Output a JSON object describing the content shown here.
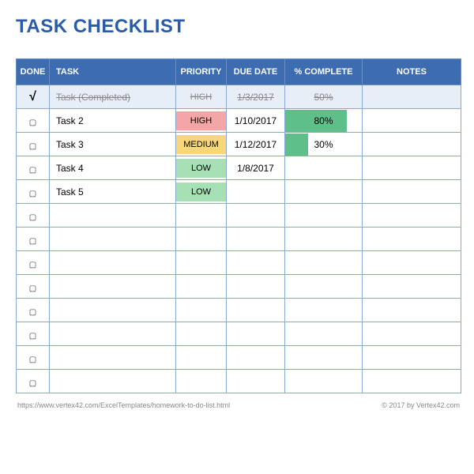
{
  "title": "TASK CHECKLIST",
  "columns": {
    "done": "DONE",
    "task": "TASK",
    "priority": "PRIORITY",
    "due": "DUE DATE",
    "pct": "% COMPLETE",
    "notes": "NOTES"
  },
  "priority_colors": {
    "HIGH": "#f4a6a6",
    "MEDIUM": "#f8d77a",
    "LOW": "#a8e0b5"
  },
  "rows": [
    {
      "done": true,
      "task": "Task (Completed)",
      "priority": "HIGH",
      "due": "1/3/2017",
      "pct": "50%",
      "pct_bar": 0,
      "notes": "",
      "strike": true
    },
    {
      "done": false,
      "task": "Task 2",
      "priority": "HIGH",
      "due": "1/10/2017",
      "pct": "80%",
      "pct_bar": 80,
      "notes": "",
      "strike": false
    },
    {
      "done": false,
      "task": "Task 3",
      "priority": "MEDIUM",
      "due": "1/12/2017",
      "pct": "30%",
      "pct_bar": 30,
      "notes": "",
      "strike": false
    },
    {
      "done": false,
      "task": "Task 4",
      "priority": "LOW",
      "due": "1/8/2017",
      "pct": "",
      "pct_bar": 0,
      "notes": "",
      "strike": false
    },
    {
      "done": false,
      "task": "Task 5",
      "priority": "LOW",
      "due": "",
      "pct": "",
      "pct_bar": 0,
      "notes": "",
      "strike": false
    },
    {
      "done": false,
      "task": "",
      "priority": "",
      "due": "",
      "pct": "",
      "pct_bar": 0,
      "notes": "",
      "strike": false
    },
    {
      "done": false,
      "task": "",
      "priority": "",
      "due": "",
      "pct": "",
      "pct_bar": 0,
      "notes": "",
      "strike": false
    },
    {
      "done": false,
      "task": "",
      "priority": "",
      "due": "",
      "pct": "",
      "pct_bar": 0,
      "notes": "",
      "strike": false
    },
    {
      "done": false,
      "task": "",
      "priority": "",
      "due": "",
      "pct": "",
      "pct_bar": 0,
      "notes": "",
      "strike": false
    },
    {
      "done": false,
      "task": "",
      "priority": "",
      "due": "",
      "pct": "",
      "pct_bar": 0,
      "notes": "",
      "strike": false
    },
    {
      "done": false,
      "task": "",
      "priority": "",
      "due": "",
      "pct": "",
      "pct_bar": 0,
      "notes": "",
      "strike": false
    },
    {
      "done": false,
      "task": "",
      "priority": "",
      "due": "",
      "pct": "",
      "pct_bar": 0,
      "notes": "",
      "strike": false
    },
    {
      "done": false,
      "task": "",
      "priority": "",
      "due": "",
      "pct": "",
      "pct_bar": 0,
      "notes": "",
      "strike": false
    }
  ],
  "footer": {
    "url": "https://www.vertex42.com/ExcelTemplates/homework-to-do-list.html",
    "copyright": "© 2017 by Vertex42.com"
  }
}
